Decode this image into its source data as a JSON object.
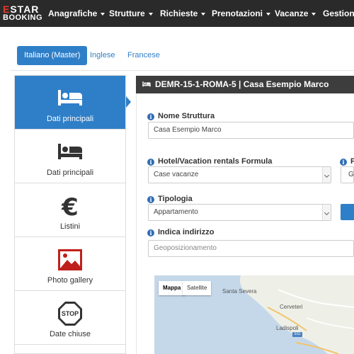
{
  "brand": {
    "line1_accent": "E",
    "line1_rest": "STAR",
    "line2": "BOOKING"
  },
  "nav": {
    "items": [
      {
        "label": "Anagrafiche"
      },
      {
        "label": "Strutture"
      },
      {
        "label": "Richieste"
      },
      {
        "label": "Prenotazioni"
      },
      {
        "label": "Vacanze"
      },
      {
        "label": "Gestione"
      }
    ]
  },
  "language_tabs": [
    {
      "label": "Italiano (Master)",
      "active": true
    },
    {
      "label": "Inglese",
      "active": false
    },
    {
      "label": "Francese",
      "active": false
    }
  ],
  "sidebar": {
    "items": [
      {
        "label": "Dati principali",
        "icon": "bed-icon",
        "active": true
      },
      {
        "label": "Dati principali",
        "icon": "bed-icon",
        "active": false
      },
      {
        "label": "Listini",
        "icon": "euro-icon",
        "active": false
      },
      {
        "label": "Photo gallery",
        "icon": "image-icon",
        "active": false
      },
      {
        "label": "Date chiuse",
        "icon": "stop-icon",
        "active": false
      }
    ],
    "stop_text": "STOP"
  },
  "panel": {
    "title": "DEMR-15-1-ROMA-5 | Casa Esempio Marco"
  },
  "form": {
    "nome_struttura": {
      "label": "Nome Struttura",
      "value": "Casa Esempio Marco"
    },
    "formula": {
      "label": "Hotel/Vacation rentals Formula",
      "value": "Case vacanze"
    },
    "right_cut": {
      "label": "F",
      "value": "G"
    },
    "tipologia": {
      "label": "Tipologia",
      "value": "Appartamento"
    },
    "indirizzo": {
      "label": "Indica indirizzo",
      "placeholder": "Geoposizionamento"
    }
  },
  "map": {
    "tabs": [
      {
        "label": "Mappa",
        "selected": true
      },
      {
        "label": "Satellite",
        "selected": false
      }
    ],
    "places": {
      "santa_severa": "Santa Severa",
      "cerveteri": "Cerveteri",
      "ladispoli": "Ladispoli",
      "road": "SS1"
    }
  },
  "colors": {
    "accent": "#2f7fc8",
    "topbar": "#2a2a2a",
    "panel_header": "#3d3d3d",
    "sea": "#c5d8ea",
    "land": "#eef0e8"
  }
}
